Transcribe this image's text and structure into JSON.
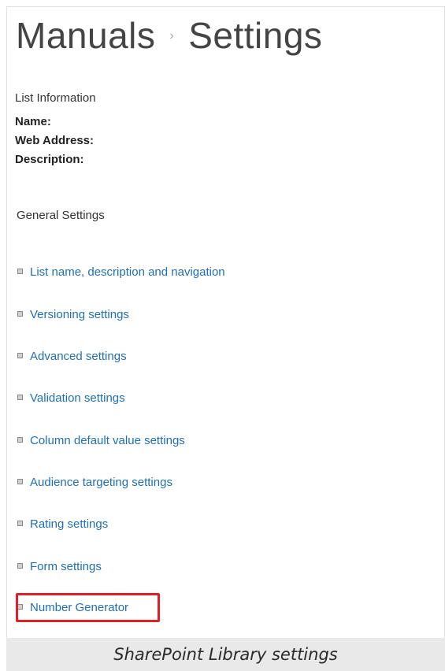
{
  "header": {
    "breadcrumb_parent": "Manuals",
    "breadcrumb_separator": "›",
    "breadcrumb_current": "Settings"
  },
  "list_information": {
    "heading": "List Information",
    "name_label": "Name:",
    "web_address_label": "Web Address:",
    "description_label": "Description:"
  },
  "general_settings": {
    "heading": "General Settings",
    "items": [
      {
        "label": "List name, description and navigation"
      },
      {
        "label": "Versioning settings"
      },
      {
        "label": "Advanced settings"
      },
      {
        "label": "Validation settings"
      },
      {
        "label": "Column default value settings"
      },
      {
        "label": "Audience targeting settings"
      },
      {
        "label": "Rating settings"
      },
      {
        "label": "Form settings"
      },
      {
        "label": "Number Generator",
        "highlighted": true
      }
    ]
  },
  "caption": {
    "text": "SharePoint Library settings"
  },
  "colors": {
    "link": "#1f6fb5",
    "highlight": "#e31e24",
    "caption_bg": "#e9e9e9"
  }
}
